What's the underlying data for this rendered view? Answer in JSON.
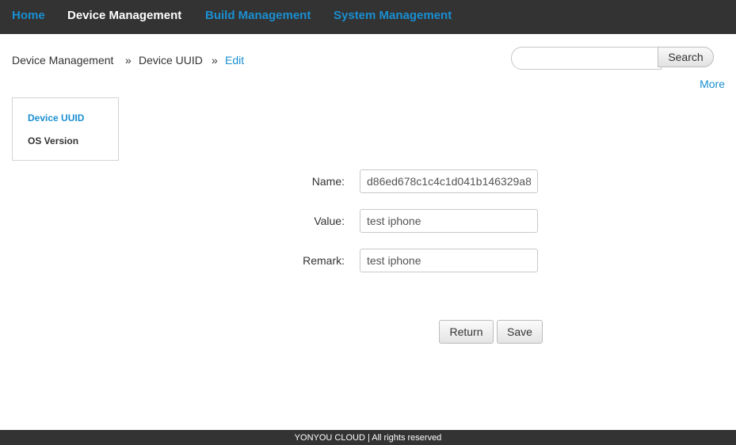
{
  "nav": {
    "items": [
      {
        "label": "Home",
        "active": false
      },
      {
        "label": "Device Management",
        "active": true
      },
      {
        "label": "Build Management",
        "active": false
      },
      {
        "label": "System Management",
        "active": false
      }
    ]
  },
  "breadcrumb": {
    "items": [
      "Device Management",
      "Device UUID",
      "Edit"
    ],
    "separator": "»"
  },
  "search": {
    "value": "",
    "button_label": "Search"
  },
  "more_label": "More",
  "sidebar": {
    "items": [
      {
        "label": "Device UUID",
        "active": true
      },
      {
        "label": "OS Version",
        "active": false
      }
    ]
  },
  "form": {
    "name_label": "Name:",
    "name_value": "d86ed678c1c4c1d041b146329a8",
    "value_label": "Value:",
    "value_value": "test iphone",
    "remark_label": "Remark:",
    "remark_value": "test iphone"
  },
  "buttons": {
    "return_label": "Return",
    "save_label": "Save"
  },
  "footer": {
    "text": "YONYOU CLOUD | All rights reserved"
  },
  "colors": {
    "topbar": "#333333",
    "link": "#1a8fd1",
    "nav_active": "#ffffff"
  }
}
